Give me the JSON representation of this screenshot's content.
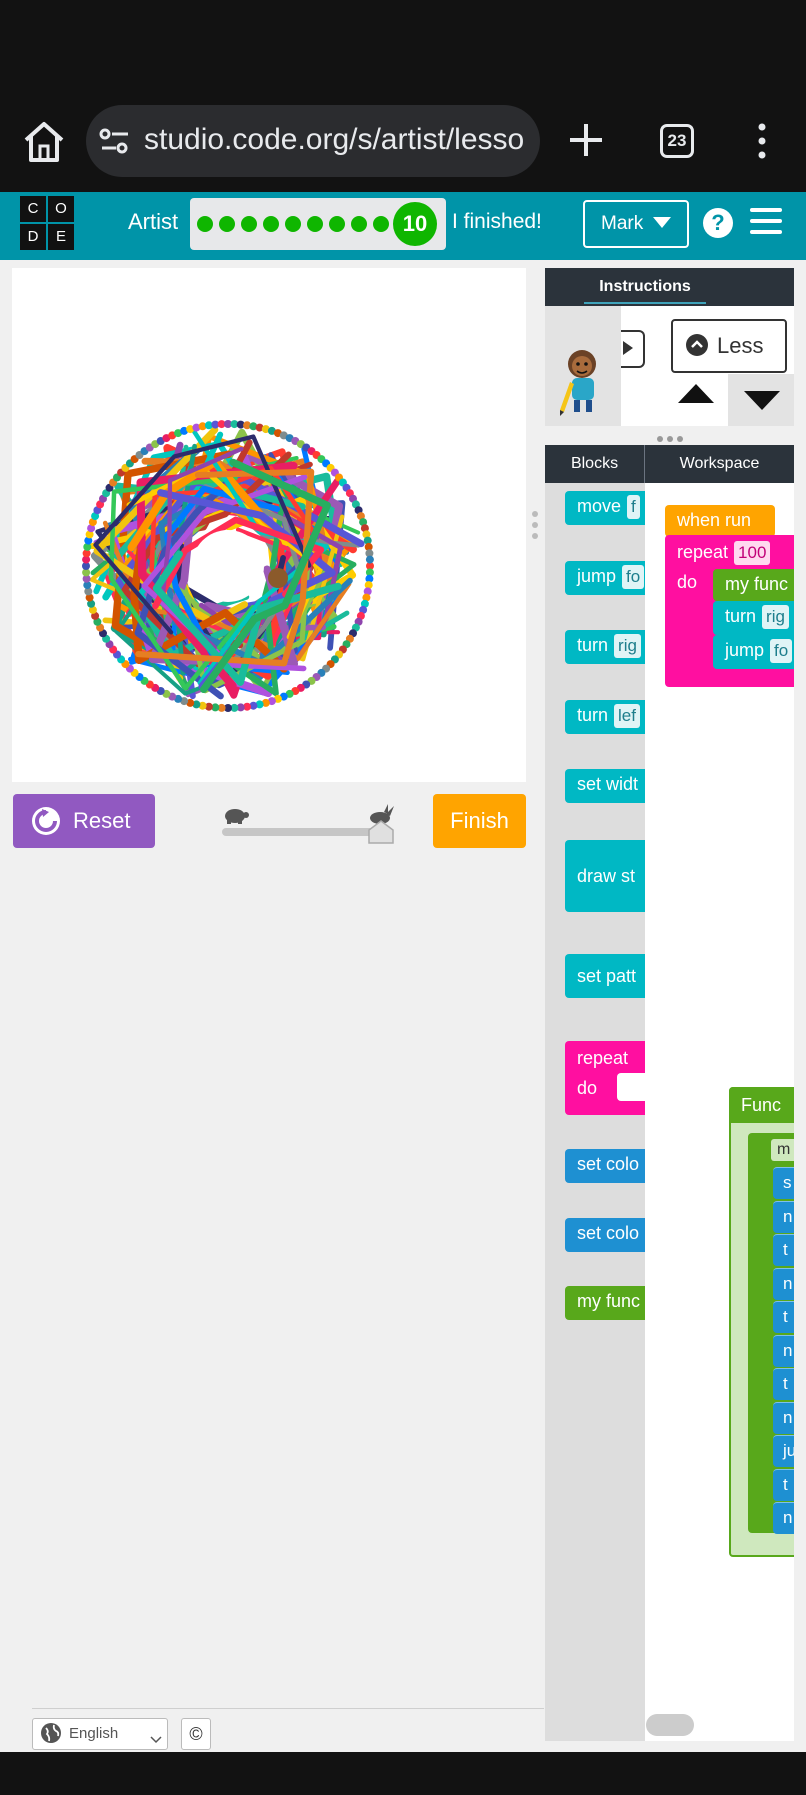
{
  "browser": {
    "url": "studio.code.org/s/artist/lesso",
    "tab_count": "23"
  },
  "header": {
    "logo_letters": [
      "C",
      "O",
      "D",
      "E"
    ],
    "level_name": "Artist",
    "current_level": "10",
    "finished_label": "I finished!",
    "user_name": "Mark",
    "help_label": "?"
  },
  "canvas": {
    "reset_label": "Reset",
    "finish_label": "Finish",
    "speed_level": 1.0
  },
  "instructions": {
    "tab_label": "Instructions",
    "less_label": "Less"
  },
  "editor": {
    "blocks_tab": "Blocks",
    "workspace_tab": "Workspace",
    "toolbox": [
      {
        "label": "move",
        "field": "f",
        "color": "teal"
      },
      {
        "label": "jump",
        "field": "fo",
        "color": "teal"
      },
      {
        "label": "turn",
        "field": "rig",
        "color": "teal"
      },
      {
        "label": "turn",
        "field": "lef",
        "color": "teal"
      },
      {
        "label": "set widt",
        "field": "",
        "color": "teal"
      },
      {
        "label": "draw st",
        "field": "",
        "color": "teal"
      },
      {
        "label": "set patt",
        "field": "",
        "color": "teal"
      },
      {
        "label": "repeat",
        "field": "",
        "color": "pink",
        "do_label": "do"
      },
      {
        "label": "set colo",
        "field": "",
        "color": "blue"
      },
      {
        "label": "set colo",
        "field": "",
        "color": "blue"
      },
      {
        "label": "my func",
        "field": "",
        "color": "green"
      }
    ],
    "program": {
      "hat": "when run",
      "repeat_label": "repeat",
      "repeat_count": "100",
      "do_label": "do",
      "inner": [
        {
          "label": "my func",
          "field": "",
          "color": "green"
        },
        {
          "label": "turn",
          "field": "rig",
          "color": "teal"
        },
        {
          "label": "jump",
          "field": "fo",
          "color": "teal"
        }
      ]
    },
    "function_def": {
      "title": "Func",
      "name_chip": "m",
      "rows": [
        "s",
        "n",
        "t",
        "n",
        "t",
        "n",
        "t",
        "n",
        "ju",
        "t",
        "n"
      ]
    }
  },
  "footer": {
    "language": "English",
    "copyright_label": "©"
  },
  "colors": {
    "header_teal": "#0094a8",
    "progress_green": "#0fb600",
    "reset_purple": "#9159c1",
    "finish_orange": "#ffa400",
    "block_teal": "#00b8c4",
    "block_pink": "#ff0fa0",
    "block_green": "#58a81b",
    "block_blue": "#1e90d2"
  }
}
